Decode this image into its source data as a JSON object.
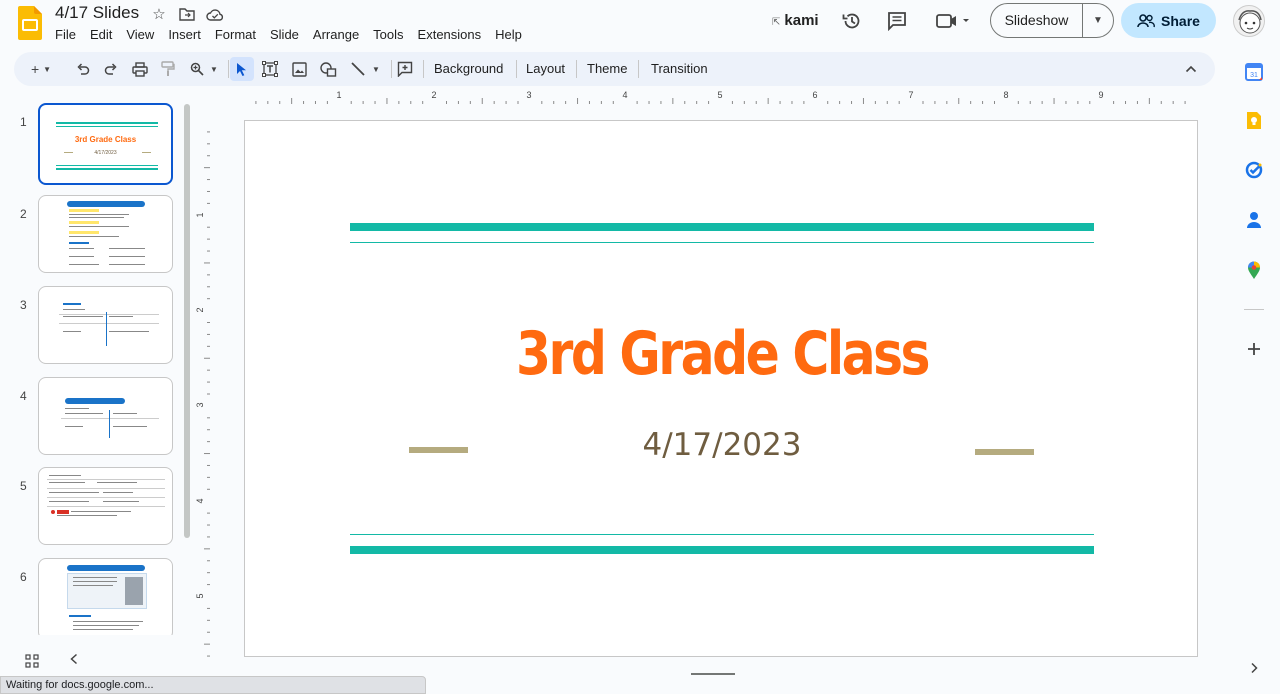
{
  "app": {
    "doc_title": "4/17 Slides",
    "menu": [
      "File",
      "Edit",
      "View",
      "Insert",
      "Format",
      "Slide",
      "Arrange",
      "Tools",
      "Extensions",
      "Help"
    ],
    "kami_label": "kami",
    "slideshow_label": "Slideshow",
    "share_label": "Share"
  },
  "toolbar": {
    "background_label": "Background",
    "layout_label": "Layout",
    "theme_label": "Theme",
    "transition_label": "Transition"
  },
  "ruler": {
    "h_labels": [
      "1",
      "2",
      "3",
      "4",
      "5",
      "6",
      "7",
      "8",
      "9"
    ],
    "v_labels": [
      "1",
      "2",
      "3",
      "4",
      "5"
    ]
  },
  "filmstrip": {
    "slide_numbers": [
      "1",
      "2",
      "3",
      "4",
      "5",
      "6"
    ],
    "thumb1_title": "3rd Grade Class",
    "thumb1_subtitle": "4/17/2023"
  },
  "slide": {
    "title": "3rd Grade Class",
    "subtitle": "4/17/2023"
  },
  "status": {
    "text": "Waiting for docs.google.com..."
  },
  "colors": {
    "accent_teal": "#13b9a6",
    "title_orange": "#ff6a10",
    "subtitle_brown": "#6f5d40",
    "dash_tan": "#b5ab7f",
    "share_bg": "#c2e7ff",
    "selected_blue": "#0b57d0"
  }
}
